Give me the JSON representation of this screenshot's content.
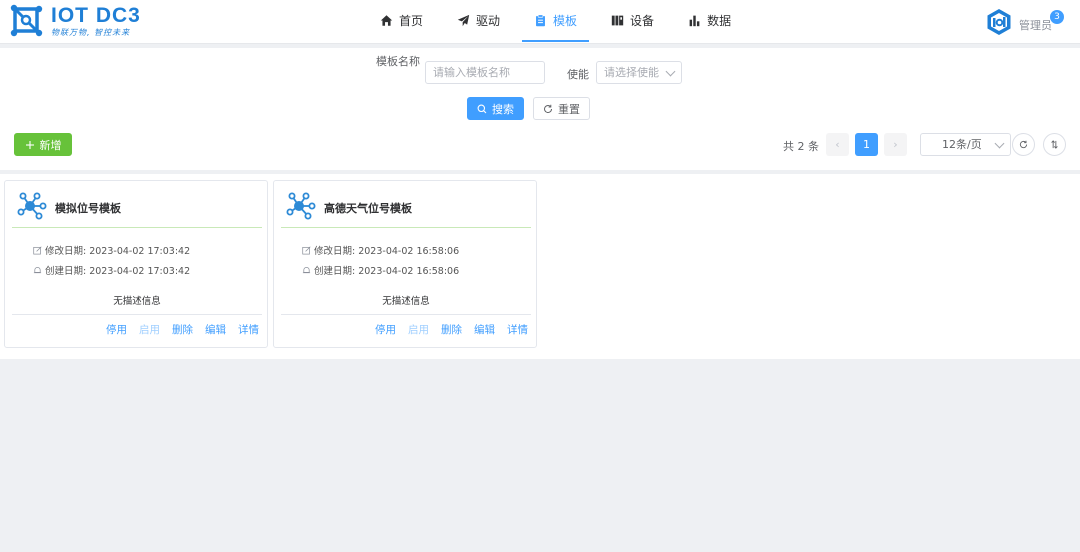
{
  "app": {
    "logo_title": "IOT DC3",
    "logo_subtitle": "物联万物, 智控未来"
  },
  "nav": {
    "items": [
      {
        "label": "首页",
        "icon": "home-icon"
      },
      {
        "label": "驱动",
        "icon": "send-icon"
      },
      {
        "label": "模板",
        "icon": "clipboard-icon",
        "active": true
      },
      {
        "label": "设备",
        "icon": "device-icon"
      },
      {
        "label": "数据",
        "icon": "bar-chart-icon"
      }
    ]
  },
  "user": {
    "name": "管理员",
    "badge_count": "3"
  },
  "search": {
    "name_label": "模板名称",
    "name_placeholder": "请输入模板名称",
    "enable_label": "使能",
    "enable_placeholder": "请选择使能",
    "search_button": "搜索",
    "reset_button": "重置"
  },
  "toolbar": {
    "add_button": "新增"
  },
  "pagination": {
    "total_text": "共 2 条",
    "current_page": "1",
    "page_size": "12条/页"
  },
  "cards": [
    {
      "title": "模拟位号模板",
      "modified": "修改日期: 2023-04-02 17:03:42",
      "created": "创建日期: 2023-04-02 17:03:42",
      "description": "无描述信息",
      "actions": [
        "停用",
        "启用",
        "删除",
        "编辑",
        "详情"
      ]
    },
    {
      "title": "高德天气位号模板",
      "modified": "修改日期: 2023-04-02 16:58:06",
      "created": "创建日期: 2023-04-02 16:58:06",
      "description": "无描述信息",
      "actions": [
        "停用",
        "启用",
        "删除",
        "编辑",
        "详情"
      ]
    }
  ],
  "colors": {
    "primary": "#409eff",
    "success": "#67c23a",
    "brand": "#1f7fd6"
  }
}
